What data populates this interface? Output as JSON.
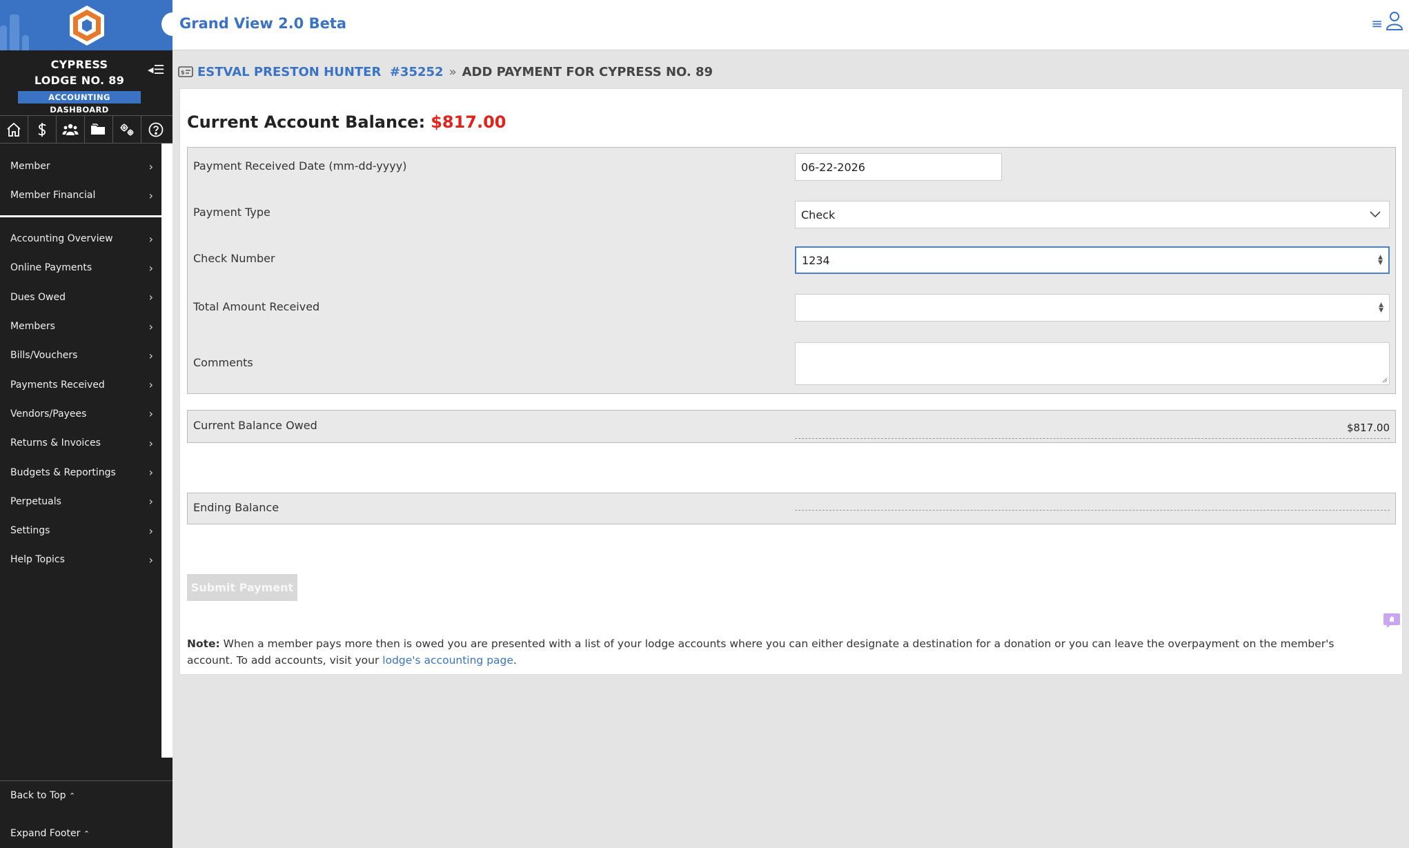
{
  "app": {
    "title": "Grand View 2.0 Beta"
  },
  "sidebar": {
    "lodge_line1": "CYPRESS",
    "lodge_line2": "LODGE NO. 89",
    "dashboard_badge": "ACCOUNTING DASHBOARD",
    "quick_icons": [
      "home-icon",
      "dollar-icon",
      "users-icon",
      "folder-icon",
      "gears-icon",
      "help-icon"
    ],
    "member_items": [
      {
        "label": "Member"
      },
      {
        "label": "Member Financial"
      }
    ],
    "accounting_items": [
      {
        "label": "Accounting Overview"
      },
      {
        "label": "Online Payments"
      },
      {
        "label": "Dues Owed"
      },
      {
        "label": "Members"
      },
      {
        "label": "Bills/Vouchers"
      },
      {
        "label": "Payments Received"
      },
      {
        "label": "Vendors/Payees"
      },
      {
        "label": "Returns & Invoices"
      },
      {
        "label": "Budgets & Reportings"
      },
      {
        "label": "Perpetuals"
      },
      {
        "label": "Settings"
      },
      {
        "label": "Help Topics"
      }
    ],
    "back_to_top": "Back to Top",
    "expand_footer": "Expand Footer"
  },
  "breadcrumb": {
    "member": "ESTVAL PRESTON HUNTER  #35252",
    "current": "ADD PAYMENT FOR CYPRESS NO. 89"
  },
  "balance": {
    "label": "Current Account Balance:",
    "value": "$817.00"
  },
  "form": {
    "date_label": "Payment Received Date (mm-dd-yyyy)",
    "date_value": "06-22-2026",
    "type_label": "Payment Type",
    "type_value": "Check",
    "check_label": "Check Number",
    "check_value": "1234",
    "amount_label": "Total Amount Received",
    "amount_value": "",
    "comments_label": "Comments",
    "comments_value": ""
  },
  "summary": {
    "balance_owed_label": "Current Balance Owed",
    "balance_owed_value": "$817.00",
    "ending_label": "Ending Balance",
    "ending_value": ""
  },
  "submit_label": "Submit Payment",
  "note": {
    "bold": "Note:",
    "text": " When a member pays more then is owed you are presented with a list of your lodge accounts where you can either designate a destination for a donation or you can leave the overpayment on the member's account. To add accounts, visit your ",
    "link": "lodge's accounting page",
    "end": "."
  },
  "colors": {
    "brand_blue": "#3a73c4",
    "balance_red": "#e2231a",
    "sidebar_bg": "#1f1f1f",
    "logo_orange": "#e8782a"
  }
}
